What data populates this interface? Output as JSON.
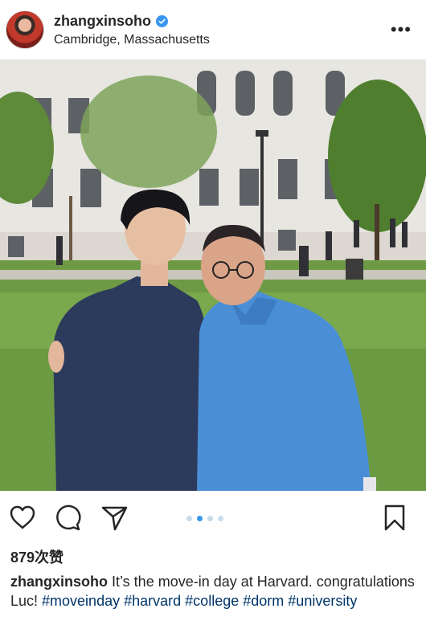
{
  "header": {
    "username": "zhangxinsoho",
    "location": "Cambridge, Massachusetts",
    "verified_icon": "verified-badge-icon",
    "more_icon": "more-options-icon",
    "more_label": "•••"
  },
  "actions": {
    "like_icon": "heart-icon",
    "comment_icon": "comment-icon",
    "share_icon": "paper-plane-icon",
    "save_icon": "bookmark-icon",
    "carousel_count": 4,
    "carousel_active": 2
  },
  "likes": "879次赞",
  "caption": {
    "username": "zhangxinsoho",
    "text": " It’s the move-in day at Harvard. congratulations Luc! ",
    "hashtags": [
      "#moveinday",
      "#harvard",
      "#college",
      "#dorm",
      "#university"
    ]
  },
  "colors": {
    "accent": "#3897f0",
    "hashtag": "#003569",
    "text": "#262626"
  }
}
